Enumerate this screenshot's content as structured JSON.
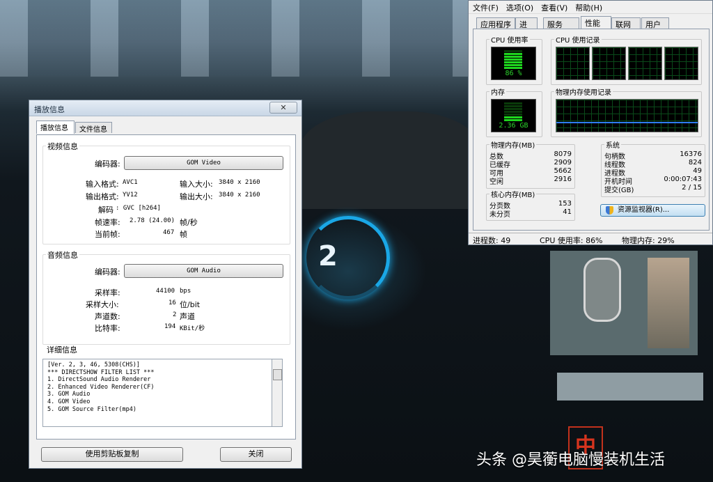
{
  "player_dialog": {
    "title": "播放信息",
    "close_glyph": "✕",
    "tabs": [
      "播放信息",
      "文件信息"
    ],
    "video": {
      "section": "视频信息",
      "codec_label": "编码器:",
      "codec_value": "GOM Video",
      "input_format_label": "输入格式:",
      "input_format": "AVC1",
      "input_size_label": "输入大小:",
      "input_size": "3840 x 2160",
      "output_format_label": "输出格式:",
      "output_format": "YV12",
      "output_size_label": "输出大小:",
      "output_size": "3840 x 2160",
      "decode_label": "解码",
      "decode_value": ": GVC  [h264]",
      "framerate_label": "帧速率:",
      "framerate_value": "2.78 (24.00)",
      "framerate_unit": "帧/秒",
      "current_frame_label": "当前帧:",
      "current_frame_value": "467",
      "current_frame_unit": "帧"
    },
    "audio": {
      "section": "音频信息",
      "codec_label": "编码器:",
      "codec_value": "GOM Audio",
      "samplerate_label": "采样率:",
      "samplerate_value": "44100",
      "samplerate_unit": "bps",
      "samplesize_label": "采样大小:",
      "samplesize_value": "16",
      "samplesize_unit": "位/bit",
      "channels_label": "声道数:",
      "channels_value": "2",
      "channels_unit": "声道",
      "bitrate_label": "比特率:",
      "bitrate_value": "194",
      "bitrate_unit": "KBit/秒"
    },
    "details": {
      "section": "详细信息",
      "lines": [
        "[Ver. 2, 3, 46, 5308(CHS)]",
        "",
        "*** DIRECTSHOW FILTER LIST ***",
        "1. DirectSound Audio Renderer",
        "2. Enhanced Video Renderer(CF)",
        "3. GOM Audio",
        "4. GOM Video",
        "5. GOM Source Filter(mp4)"
      ]
    },
    "copy_button": "使用剪贴板复制",
    "close_button": "关闭"
  },
  "task_manager": {
    "menu": [
      "文件(F)",
      "选项(O)",
      "查看(V)",
      "帮助(H)"
    ],
    "tabs": [
      "应用程序",
      "进程",
      "服务",
      "性能",
      "联网",
      "用户"
    ],
    "active_tab": "性能",
    "cpu_usage_label": "CPU 使用率",
    "cpu_usage_value": "86 %",
    "cpu_history_label": "CPU 使用记录",
    "memory_label": "内存",
    "memory_value": "2.36 GB",
    "memory_history_label": "物理内存使用记录",
    "physical_memory": {
      "title": "物理内存(MB)",
      "rows": [
        {
          "label": "总数",
          "value": "8079"
        },
        {
          "label": "已缓存",
          "value": "2909"
        },
        {
          "label": "可用",
          "value": "5662"
        },
        {
          "label": "空闲",
          "value": "2916"
        }
      ]
    },
    "kernel_memory": {
      "title": "核心内存(MB)",
      "rows": [
        {
          "label": "分页数",
          "value": "153"
        },
        {
          "label": "未分页",
          "value": "41"
        }
      ]
    },
    "system": {
      "title": "系统",
      "rows": [
        {
          "label": "句柄数",
          "value": "16376"
        },
        {
          "label": "线程数",
          "value": "824"
        },
        {
          "label": "进程数",
          "value": "49"
        },
        {
          "label": "开机时间",
          "value": "0:00:07:43"
        },
        {
          "label": "提交(GB)",
          "value": "2 / 15"
        }
      ]
    },
    "resource_monitor_button": "资源监视器(R)...",
    "status": {
      "processes": "进程数: 49",
      "cpu": "CPU 使用率: 86%",
      "memory": "物理内存: 29%"
    },
    "cpu_usage_fraction": 0.86,
    "memory_usage_fraction": 0.29
  },
  "background": {
    "gauge_number": "2",
    "badge_text": "中",
    "watermark": "头条 @昊蘅电脑慢装机生活"
  },
  "colors": {
    "meter_green": "#1ed61e",
    "gauge_blue": "#1aa7e6"
  }
}
